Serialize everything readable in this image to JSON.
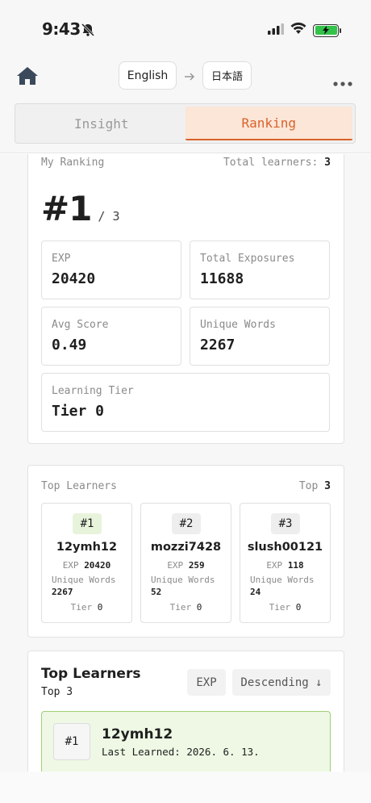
{
  "status_bar": {
    "time": "9:43"
  },
  "nav": {
    "source_lang": "English",
    "target_lang": "日本語"
  },
  "tabs": [
    {
      "label": "Insight",
      "active": false
    },
    {
      "label": "Ranking",
      "active": true
    }
  ],
  "colors": {
    "accent": "#d9622b",
    "tab_active_bg": "#fbe6d8",
    "highlight_green": "#eef8e4",
    "battery": "#33c34a"
  },
  "my_ranking": {
    "title": "My Ranking",
    "total_learners_label": "Total learners:",
    "total_learners": "3",
    "rank": "#1",
    "rank_of": "/ 3",
    "stats": {
      "exp_label": "EXP",
      "exp_value": "20420",
      "exposures_label": "Total Exposures",
      "exposures_value": "11688",
      "avg_label": "Avg Score",
      "avg_value": "0.49",
      "unique_label": "Unique Words",
      "unique_value": "2267",
      "tier_label": "Learning Tier",
      "tier_value": "Tier 0"
    }
  },
  "top_learners": {
    "title": "Top Learners",
    "count_label": "Top",
    "count": "3",
    "exp_label": "EXP",
    "unique_label": "Unique Words",
    "tier_label": "Tier",
    "learners": [
      {
        "rank": "#1",
        "name": "12ymh12",
        "exp": "20420",
        "unique_words": "2267",
        "tier": "0"
      },
      {
        "rank": "#2",
        "name": "mozzi7428",
        "exp": "259",
        "unique_words": "52",
        "tier": "0"
      },
      {
        "rank": "#3",
        "name": "slush00121",
        "exp": "118",
        "unique_words": "24",
        "tier": "0"
      }
    ]
  },
  "leaderboard": {
    "title": "Top Learners",
    "subtitle": "Top 3",
    "sort_field": "EXP",
    "sort_order": "Descending ↓",
    "entries": [
      {
        "rank": "#1",
        "name": "12ymh12",
        "last_learned": "Last Learned: 2026. 6. 13."
      }
    ]
  }
}
